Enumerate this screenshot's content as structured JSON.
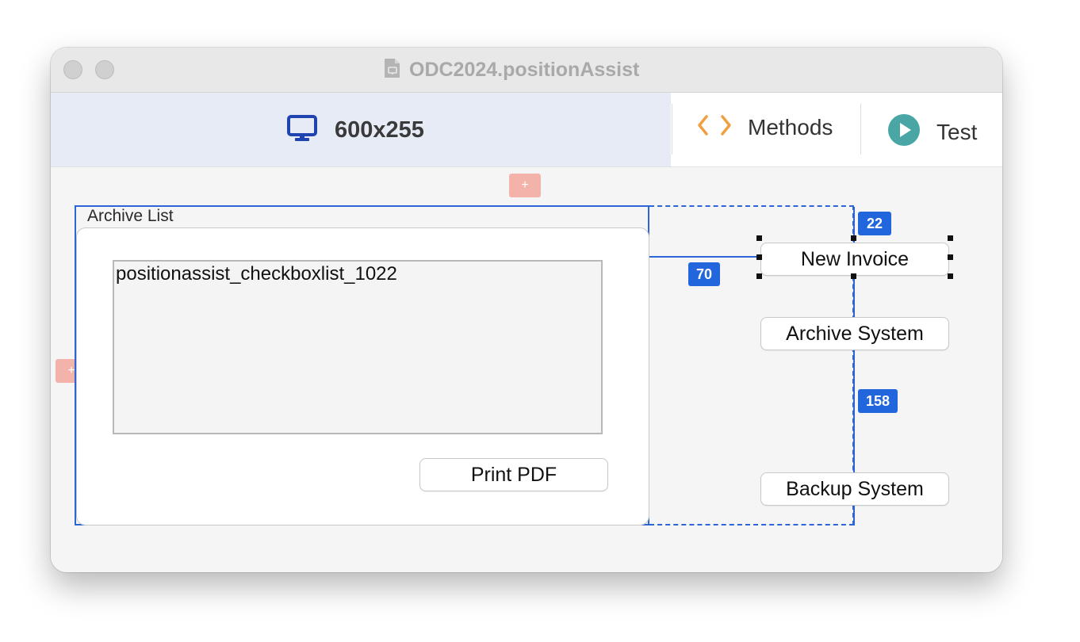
{
  "window": {
    "title": "ODC2024.positionAssist",
    "icons": {
      "document": "document-icon"
    }
  },
  "toolbar": {
    "screen_size_label": "600x255",
    "screen_icon": "monitor-icon",
    "methods_label": "Methods",
    "methods_icon": "code-brackets-icon",
    "test_label": "Test",
    "test_icon": "play-circle-icon"
  },
  "canvas": {
    "add_top_label": "+",
    "add_left_label": "+",
    "group": {
      "caption": "Archive List",
      "checkbox_list_name": "positionassist_checkboxlist_1022",
      "print_button_label": "Print PDF"
    },
    "buttons": {
      "new_invoice_label": "New Invoice",
      "archive_system_label": "Archive System",
      "backup_system_label": "Backup System"
    },
    "measurements": {
      "top_gap": "22",
      "left_gap": "70",
      "bottom_gap": "158"
    }
  },
  "colors": {
    "selection_blue": "#2d65d8",
    "badge_blue": "#2266dd",
    "toolbar_active_bg": "#e6ebf6",
    "methods_orange": "#f0a040",
    "test_teal": "#4aa5a5",
    "add_button_pink": "#f3b3aa"
  }
}
